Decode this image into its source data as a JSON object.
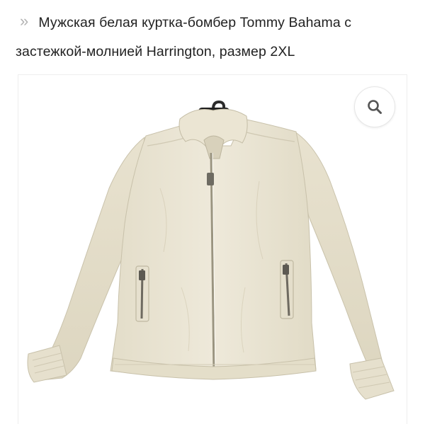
{
  "product": {
    "title": "Мужская белая куртка-бомбер Tommy Bahama с застежкой-молнией Harrington, размер 2XL",
    "breadcrumb_icon": "double-chevron-right-icon"
  },
  "gallery": {
    "zoom_icon": "search-icon",
    "image_subject": "jacket"
  },
  "colors": {
    "title_text": "#222222",
    "chevron": "#b3b3b3",
    "zoom_icon": "#555555",
    "jacket": "#ece7d6"
  }
}
